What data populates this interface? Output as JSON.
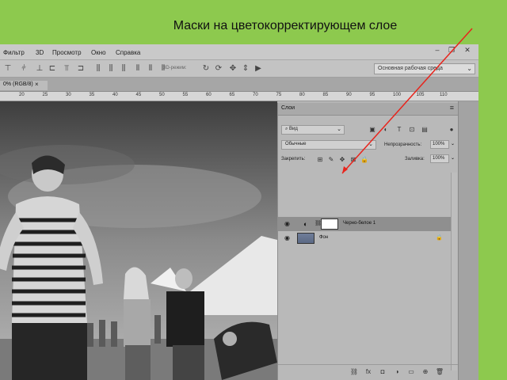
{
  "slide": {
    "title": "Маски на цветокорректирующем слое"
  },
  "menu": {
    "items": [
      "Фильтр",
      "3D",
      "Просмотр",
      "Окно",
      "Справка"
    ]
  },
  "options_bar": {
    "mode_3d_label": "3D-режим:",
    "workspace": "Основная рабочая среда"
  },
  "document": {
    "tab_label": "0% (RGB/8)"
  },
  "ruler": {
    "ticks": [
      "20",
      "25",
      "30",
      "35",
      "40",
      "45",
      "50",
      "55",
      "60",
      "65",
      "70",
      "75",
      "80",
      "85",
      "90",
      "95",
      "100",
      "105",
      "110"
    ]
  },
  "layers_panel": {
    "tab": "Слои",
    "filter_kind": "Вид",
    "blend_mode": "Обычные",
    "opacity_label": "Непрозрачность:",
    "opacity_value": "100%",
    "lock_label": "Закрепить:",
    "fill_label": "Заливка:",
    "fill_value": "100%",
    "layers": [
      {
        "name": "Черно-белое 1",
        "selected": true
      },
      {
        "name": "Фон",
        "selected": false
      }
    ]
  },
  "colors": {
    "slide_bg": "#8dc94e",
    "arrow": "#e8241c"
  }
}
